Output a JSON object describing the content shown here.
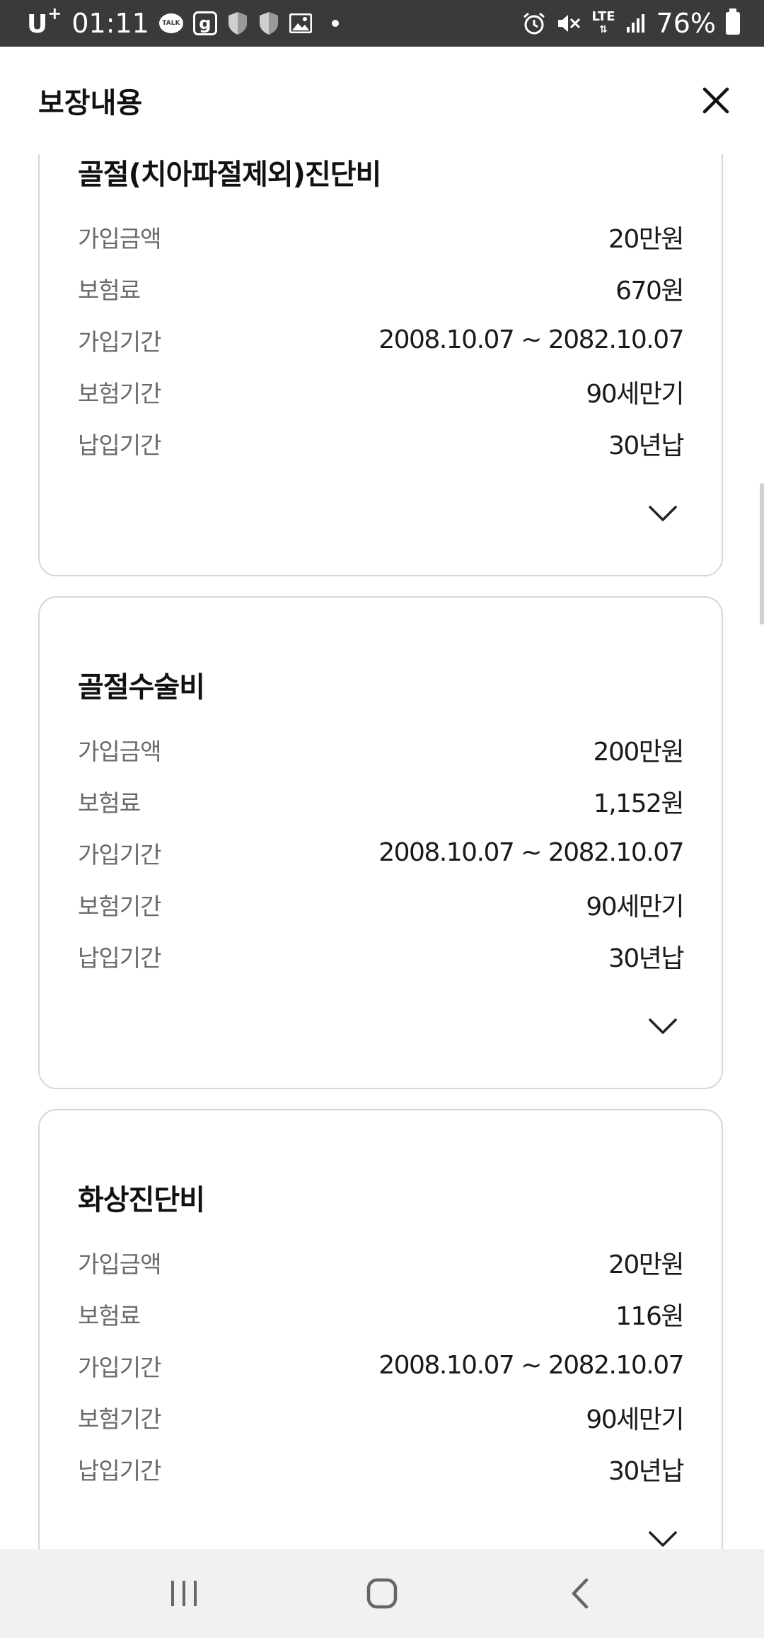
{
  "status_bar": {
    "carrier": "U",
    "carrier_sup": "+",
    "time": "01:11",
    "talk_label": "TALK",
    "g_label": "g",
    "network": "LTE",
    "battery": "76%"
  },
  "header": {
    "title": "보장내용"
  },
  "cards": [
    {
      "title": "골절(치아파절제외)진단비",
      "rows": [
        {
          "label": "가입금액",
          "value": "20만원"
        },
        {
          "label": "보험료",
          "value": "670원"
        },
        {
          "label": "가입기간",
          "value": "2008.10.07 ~ 2082.10.07"
        },
        {
          "label": "보험기간",
          "value": "90세만기"
        },
        {
          "label": "납입기간",
          "value": "30년납"
        }
      ]
    },
    {
      "title": "골절수술비",
      "rows": [
        {
          "label": "가입금액",
          "value": "200만원"
        },
        {
          "label": "보험료",
          "value": "1,152원"
        },
        {
          "label": "가입기간",
          "value": "2008.10.07 ~ 2082.10.07"
        },
        {
          "label": "보험기간",
          "value": "90세만기"
        },
        {
          "label": "납입기간",
          "value": "30년납"
        }
      ]
    },
    {
      "title": "화상진단비",
      "rows": [
        {
          "label": "가입금액",
          "value": "20만원"
        },
        {
          "label": "보험료",
          "value": "116원"
        },
        {
          "label": "가입기간",
          "value": "2008.10.07 ~ 2082.10.07"
        },
        {
          "label": "보험기간",
          "value": "90세만기"
        },
        {
          "label": "납입기간",
          "value": "30년납"
        }
      ]
    }
  ]
}
